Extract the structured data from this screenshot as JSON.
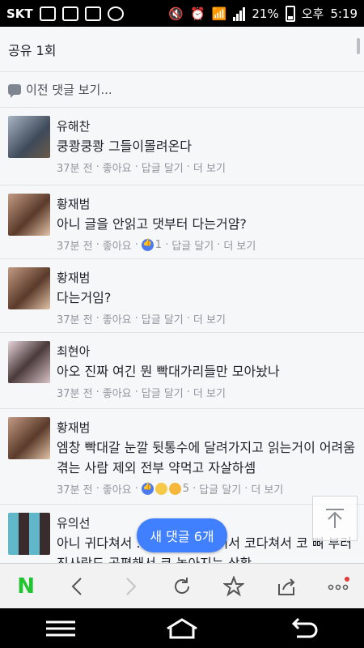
{
  "status_bar": {
    "carrier": "SKT",
    "battery": "21%",
    "time_period": "오후",
    "time": "5:19"
  },
  "share": {
    "label": "공유 1회"
  },
  "previous_comments": {
    "label": "이전 댓글 보기..."
  },
  "comments": [
    {
      "name": "유해찬",
      "text": "쿵쾅쿵쾅 그들이몰려온다",
      "time": "37분 전",
      "like": "좋아요",
      "reactions": "",
      "reply": "답글 달기",
      "more": "더 보기"
    },
    {
      "name": "황재범",
      "text": "아니 글을 안읽고 댓부터 다는거얌?",
      "time": "37분 전",
      "like": "좋아요",
      "reactions": "1",
      "reply": "답글 달기",
      "more": "더 보기"
    },
    {
      "name": "황재범",
      "text": "다는거임?",
      "time": "37분 전",
      "like": "좋아요",
      "reactions": "",
      "reply": "답글 달기",
      "more": "더 보기"
    },
    {
      "name": "최현아",
      "text": "아오 진짜 여긴 뭔 빡대가리들만 모아놨나",
      "time": "37분 전",
      "like": "좋아요",
      "reactions": "",
      "reply": "답글 달기",
      "more": "더 보기"
    },
    {
      "name": "황재범",
      "text": "엠창 빡대갈 눈깔 뒷통수에 달려가지고 읽는거이 어려움 겪는 사람 제외 전부 약먹고 자살하셈",
      "time": "37분 전",
      "like": "좋아요",
      "reactions": "5",
      "reply": "답글 달기",
      "more": "더 보기"
    },
    {
      "name": "유의선",
      "text": "아니 귀다쳐서 ... 예요 예를들어서 코다쳐서 코 뼈 부러진사람도 공평해서 코 높아지는 상황",
      "time": "",
      "like": "",
      "reactions": "",
      "reply": "",
      "more": ""
    }
  ],
  "new_comments_pill": {
    "label": "새 댓글 6개"
  },
  "colors": {
    "accent": "#4080ff",
    "naver_green": "#20c531",
    "meta_gray": "#90949c"
  }
}
